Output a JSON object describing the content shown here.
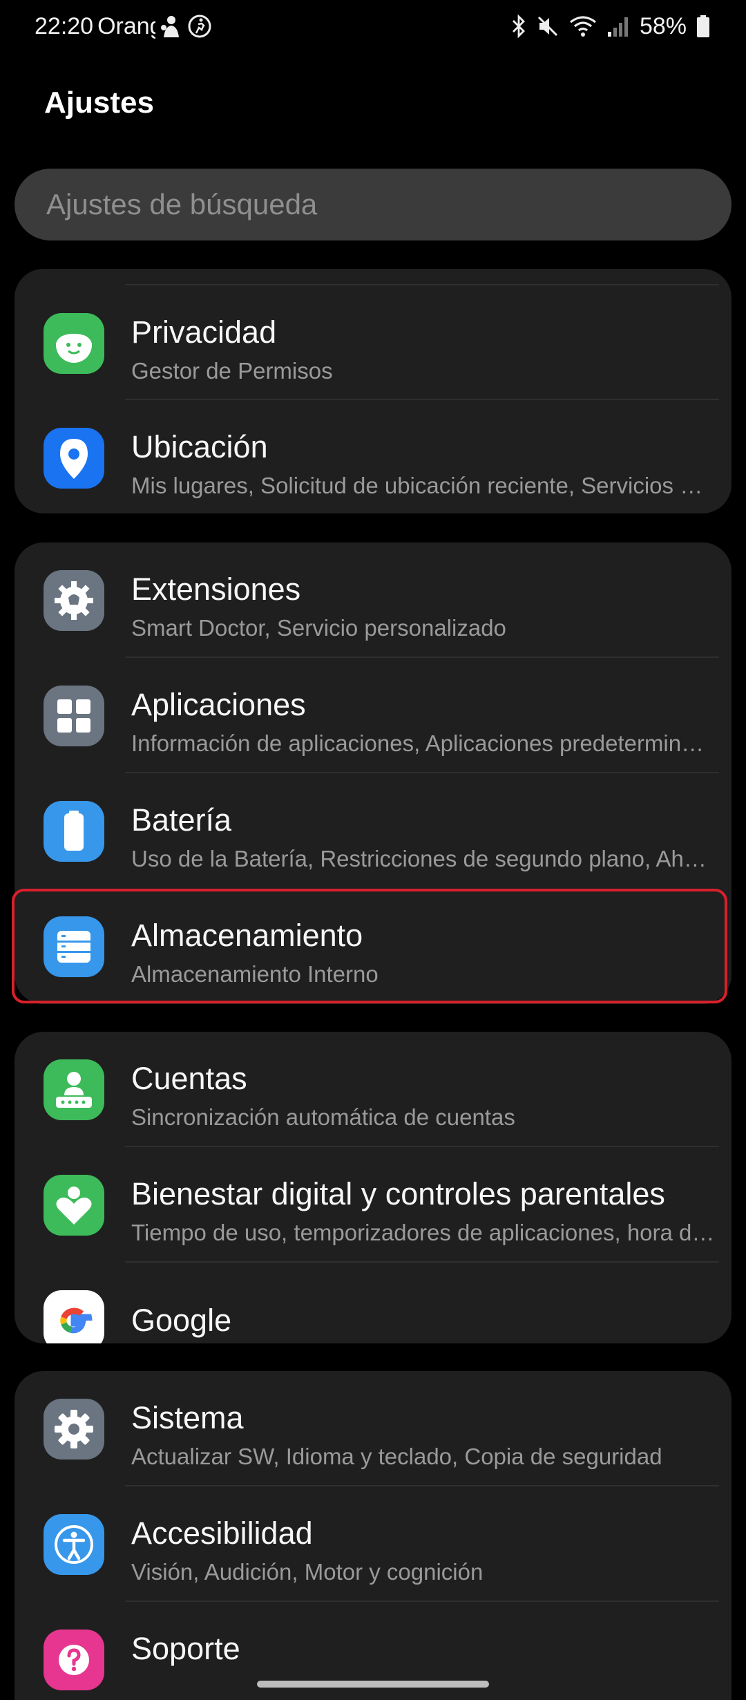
{
  "status_bar": {
    "time": "22:20",
    "carrier": "Orange",
    "battery": "58%"
  },
  "header": {
    "title": "Ajustes"
  },
  "search": {
    "placeholder": "Ajustes de búsqueda"
  },
  "cards": [
    {
      "items": [
        {
          "icon": "privacy-icon",
          "title": "Privacidad",
          "subtitle": "Gestor de Permisos",
          "color": "#3dbb5a"
        },
        {
          "icon": "location-pin-icon",
          "title": "Ubicación",
          "subtitle": "Mis lugares, Solicitud de ubicación reciente, Servicios de ubicación",
          "color": "#1a73f0"
        }
      ]
    },
    {
      "items": [
        {
          "icon": "extensions-icon",
          "title": "Extensiones",
          "subtitle": "Smart Doctor, Servicio personalizado",
          "color": "#6a7581"
        },
        {
          "icon": "apps-grid-icon",
          "title": "Aplicaciones",
          "subtitle": "Información de aplicaciones, Aplicaciones predeterminadas",
          "color": "#6a7581"
        },
        {
          "icon": "battery-icon",
          "title": "Batería",
          "subtitle": "Uso de la Batería, Restricciones de segundo plano, Ahorro de energía",
          "color": "#3797ea"
        },
        {
          "icon": "storage-icon",
          "title": "Almacenamiento",
          "subtitle": "Almacenamiento Interno",
          "color": "#3797ea"
        }
      ]
    },
    {
      "items": [
        {
          "icon": "accounts-icon",
          "title": "Cuentas",
          "subtitle": "Sincronización automática de cuentas",
          "color": "#3dbb5a"
        },
        {
          "icon": "digital-wellbeing-icon",
          "title": "Bienestar digital y controles parentales",
          "subtitle": "Tiempo de uso, temporizadores de aplicaciones, hora de dormir",
          "color": "#3dbb5a"
        },
        {
          "icon": "google-icon",
          "title": "Google",
          "subtitle": "",
          "color": "#ffffff"
        }
      ]
    },
    {
      "items": [
        {
          "icon": "system-gear-icon",
          "title": "Sistema",
          "subtitle": "Actualizar SW, Idioma y teclado, Copia de seguridad",
          "color": "#6a7581"
        },
        {
          "icon": "accessibility-icon",
          "title": "Accesibilidad",
          "subtitle": "Visión, Audición, Motor y cognición",
          "color": "#3797ea"
        },
        {
          "icon": "support-question-icon",
          "title": "Soporte",
          "subtitle": "",
          "color": "#e6368f"
        }
      ]
    }
  ]
}
